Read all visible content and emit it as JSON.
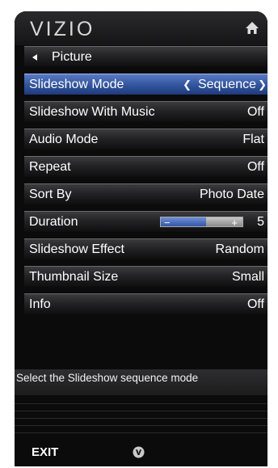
{
  "header": {
    "logo_text": "VIZIO",
    "home_icon": "home-icon"
  },
  "breadcrumb": {
    "label": "Picture",
    "icon": "back-arrow-icon"
  },
  "menu": [
    {
      "label": "Slideshow Mode",
      "value": "Sequence",
      "selected": true
    },
    {
      "label": "Slideshow With Music",
      "value": "Off"
    },
    {
      "label": "Audio Mode",
      "value": "Flat"
    },
    {
      "label": "Repeat",
      "value": "Off"
    },
    {
      "label": "Sort By",
      "value": "Photo Date"
    },
    {
      "label": "Duration",
      "value": "5",
      "slider_level": 0.55,
      "minus": "−",
      "plus": "+"
    },
    {
      "label": "Slideshow Effect",
      "value": "Random"
    },
    {
      "label": "Thumbnail Size",
      "value": "Small"
    },
    {
      "label": "Info",
      "value": "Off"
    }
  ],
  "help_text": "Select the Slideshow sequence mode",
  "footer": {
    "exit_label": "EXIT",
    "v_icon": "v-button-icon"
  },
  "colors": {
    "selected_row": "#34579f",
    "panel_background": "#0b0b0c"
  }
}
